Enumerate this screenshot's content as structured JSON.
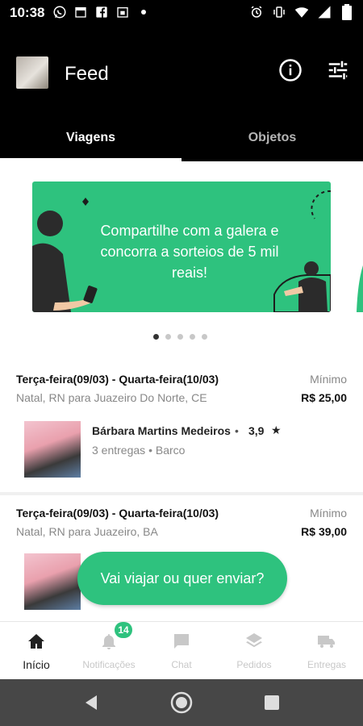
{
  "status_bar": {
    "time": "10:38",
    "icons_left": [
      "whatsapp-icon",
      "calendar-icon",
      "facebook-icon",
      "calendar-31-icon",
      "dot-icon"
    ],
    "icons_right": [
      "alarm-icon",
      "vibrate-icon",
      "wifi-icon",
      "signal-icon",
      "battery-icon"
    ]
  },
  "header": {
    "title": "Feed"
  },
  "tabs": [
    {
      "label": "Viagens",
      "active": true
    },
    {
      "label": "Objetos",
      "active": false
    }
  ],
  "banner": {
    "line1": "Compartilhe com a galera e",
    "line2": "concorra a sorteios de 5 mil reais!",
    "color": "#2ec27e"
  },
  "carousel": {
    "count": 5,
    "active_index": 0
  },
  "trips": [
    {
      "dates": "Terça-feira(09/03) - Quarta-feira(10/03)",
      "route": "Natal, RN para Juazeiro Do Norte, CE",
      "price_label": "Mínimo",
      "price": "R$ 25,00",
      "driver_name": "Bárbara Martins Medeiros",
      "separator": "•",
      "rating": "3,9",
      "deliveries": "3 entregas",
      "meta_separator": "•",
      "vehicle": "Barco"
    },
    {
      "dates": "Terça-feira(09/03) - Quarta-feira(10/03)",
      "route": "Natal, RN para Juazeiro, BA",
      "price_label": "Mínimo",
      "price": "R$ 39,00"
    }
  ],
  "fab": {
    "label": "Vai viajar ou quer enviar?"
  },
  "bottom_nav": [
    {
      "label": "Início",
      "icon": "home-icon",
      "active": true
    },
    {
      "label": "Notificações",
      "icon": "bell-icon",
      "badge": "14"
    },
    {
      "label": "Chat",
      "icon": "chat-icon"
    },
    {
      "label": "Pedidos",
      "icon": "layers-icon"
    },
    {
      "label": "Entregas",
      "icon": "truck-icon"
    }
  ],
  "colors": {
    "accent": "#2ec27e",
    "app_bar": "#000000"
  }
}
